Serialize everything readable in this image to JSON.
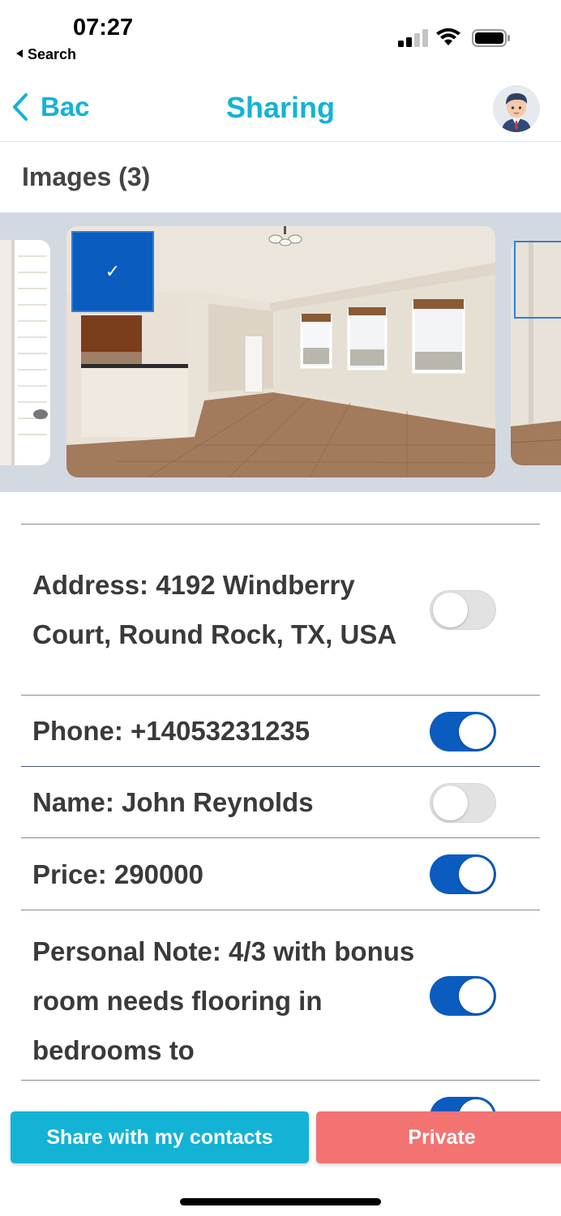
{
  "status_bar": {
    "time": "07:27",
    "back_app": "Search",
    "icons": [
      "signal-icon",
      "wifi-icon",
      "battery-icon"
    ]
  },
  "nav": {
    "back_label": "Bac",
    "title": "Sharing",
    "avatar_icon": "avatar-icon"
  },
  "images_section": {
    "title": "Images (3)",
    "selected_mark": "✓"
  },
  "fields": [
    {
      "label": "Address: 4192 Windberry Court, Round Rock, TX, USA",
      "enabled": false
    },
    {
      "label": "Phone: +14053231235",
      "enabled": true
    },
    {
      "label": "Name: John Reynolds",
      "enabled": false
    },
    {
      "label": "Price: 290000",
      "enabled": true
    },
    {
      "label": "Personal Note: 4/3 with bonus room needs flooring in bedrooms to",
      "enabled": true
    }
  ],
  "actions": {
    "share_label": "Share with my contacts",
    "private_label": "Private"
  },
  "colors": {
    "accent": "#13b3d6",
    "toggle_on": "#0b5cbf",
    "private": "#f37373",
    "gallery_bg": "#d3d9e1"
  }
}
